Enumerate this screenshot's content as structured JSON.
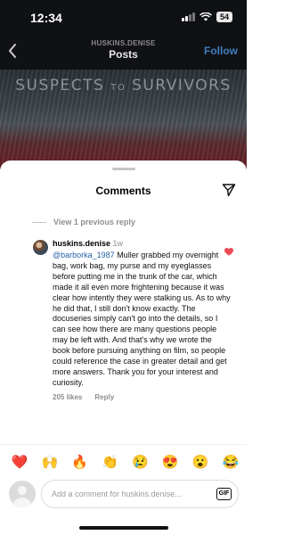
{
  "status_bar": {
    "time": "12:34",
    "battery": "54"
  },
  "nav": {
    "username": "HUSKINS.DENISE",
    "title": "Posts",
    "follow_label": "Follow"
  },
  "banner": {
    "title_main": "SUSPECTS",
    "title_small": "TO",
    "title_end": "SURVIVORS"
  },
  "sheet": {
    "title": "Comments",
    "view_previous": "View 1 previous reply"
  },
  "comment": {
    "username": "huskins.denise",
    "time": "1w",
    "mention": "@barborka_1987",
    "text": " Muller grabbed my overnight bag, work bag, my purse and my eyeglasses before putting me in the trunk of the car, which made it all even more frightening because it was clear how intently they were stalking us. As to why he did that, I still don't know exactly. The docuseries simply can't go into the details, so I can see how there are many questions people may be left with. And that's why we wrote the book before pursuing anything on film, so people could reference the case in greater detail and get more answers. Thank you for your interest and curiosity.",
    "likes": "205 likes",
    "reply_label": "Reply",
    "liked": true
  },
  "emoji_bar": [
    "❤️",
    "🙌",
    "🔥",
    "👏",
    "😢",
    "😍",
    "😮",
    "😂"
  ],
  "composer": {
    "placeholder": "Add a comment for huskins.denise...",
    "gif_label": "GIF"
  },
  "colors": {
    "accent": "#2563a8",
    "heart": "#ed4956"
  }
}
